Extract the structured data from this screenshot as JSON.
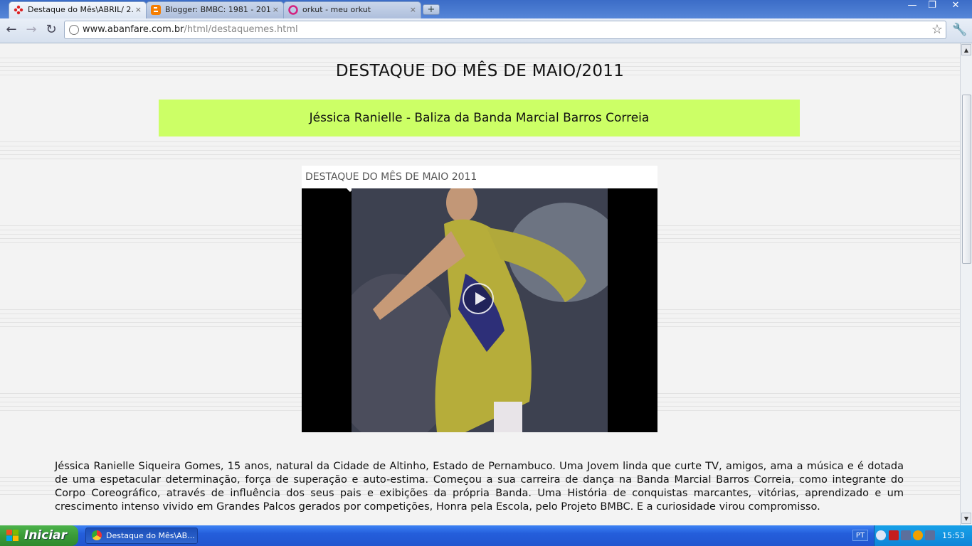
{
  "browser": {
    "tabs": [
      {
        "label": "Destaque do Mês\\ABRIL/ 2...",
        "active": true,
        "favicon": "flower-icon"
      },
      {
        "label": "Blogger: BMBC: 1981 - 201...",
        "active": false,
        "favicon": "blogger-icon"
      },
      {
        "label": "orkut - meu orkut",
        "active": false,
        "favicon": "orkut-icon"
      }
    ],
    "tab_close": "×",
    "new_tab": "+",
    "window_controls": {
      "minimize": "—",
      "restore": "❐",
      "close": "✕"
    },
    "nav": {
      "back": "←",
      "forward": "→",
      "reload": "↻"
    },
    "url_domain": "www.abanfare.com.br",
    "url_path": "/html/destaquemes.html",
    "star": "☆",
    "wrench": "🔧"
  },
  "page": {
    "heading": "DESTAQUE DO MÊS DE MAIO/2011",
    "banner": "Jéssica Ranielle -  Baliza da Banda Marcial Barros Correia",
    "video_title": "DESTAQUE DO MÊS DE MAIO 2011",
    "description": "Jéssica Ranielle Siqueira Gomes, 15 anos, natural da Cidade de Altinho, Estado de Pernambuco. Uma Jovem linda que curte TV, amigos, ama a música e é dotada de uma espetacular determinação, força de superação e auto-estima. Começou a sua carreira de dança na Banda Marcial Barros Correia, como integrante do Corpo Coreográfico, através de influência dos seus pais e exibições da própria Banda. Uma História de conquistas marcantes, vitórias, aprendizado e um crescimento intenso vivido em Grandes Palcos gerados por competições, Honra pela Escola, pelo Projeto BMBC. E a curiosidade virou compromisso."
  },
  "scrollbar": {
    "up": "▲",
    "down": "▼"
  },
  "taskbar": {
    "start_label": "Iniciar",
    "task_item": "Destaque do Mês\\AB...",
    "language": "PT",
    "clock": "15:53"
  }
}
